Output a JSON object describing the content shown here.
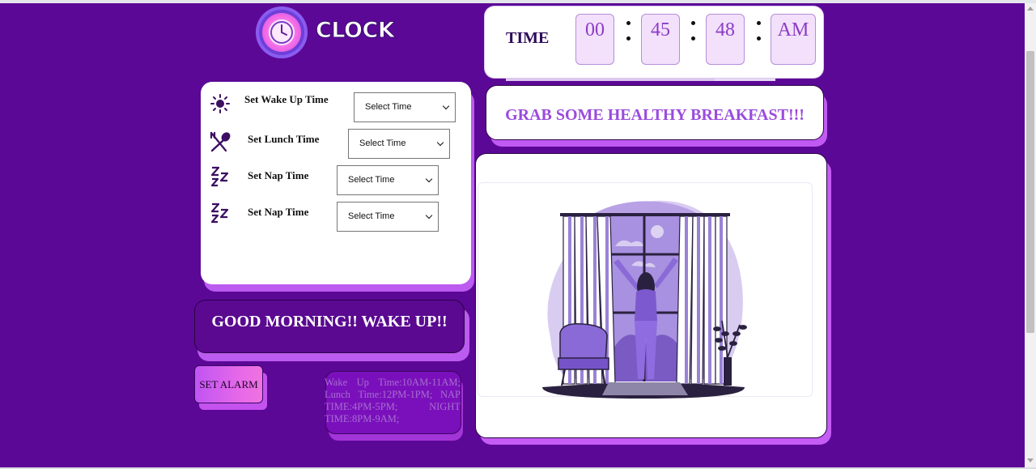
{
  "logo": {
    "text": "CLOCK",
    "icon": "clock-icon"
  },
  "clock": {
    "label": "TIME",
    "hours": "00",
    "minutes": "45",
    "seconds": "48",
    "period": "AM",
    "separator": ":"
  },
  "settings": {
    "rows": [
      {
        "label": "Set Wake Up Time",
        "icon": "sun-icon",
        "selected": "Select Time"
      },
      {
        "label": "Set Lunch Time",
        "icon": "utensils-icon",
        "selected": "Select Time"
      },
      {
        "label": "Set Nap Time",
        "icon": "sleep-zzz-icon",
        "selected": "Select Time"
      },
      {
        "label": "Set Nap Time",
        "icon": "sleep-zzz-icon",
        "selected": "Select Time"
      }
    ]
  },
  "greeting": "GOOD MORNING!! WAKE UP!!",
  "alarm_button": "SET ALARM",
  "schedule_note": "Wake Up Time:10AM-11AM; Lunch Time:12PM-1PM; NAP TIME:4PM-5PM; NIGHT TIME:8PM-9AM;",
  "banner": "GRAB SOME HEALTHY BREAKFAST!!!",
  "illustration": {
    "icon": "woman-opening-curtains-illustration"
  },
  "colors": {
    "background": "#5c0896",
    "accent": "#bc5bf0",
    "banner_text": "#9a4bdc",
    "time_box": "#f3e0fb"
  }
}
